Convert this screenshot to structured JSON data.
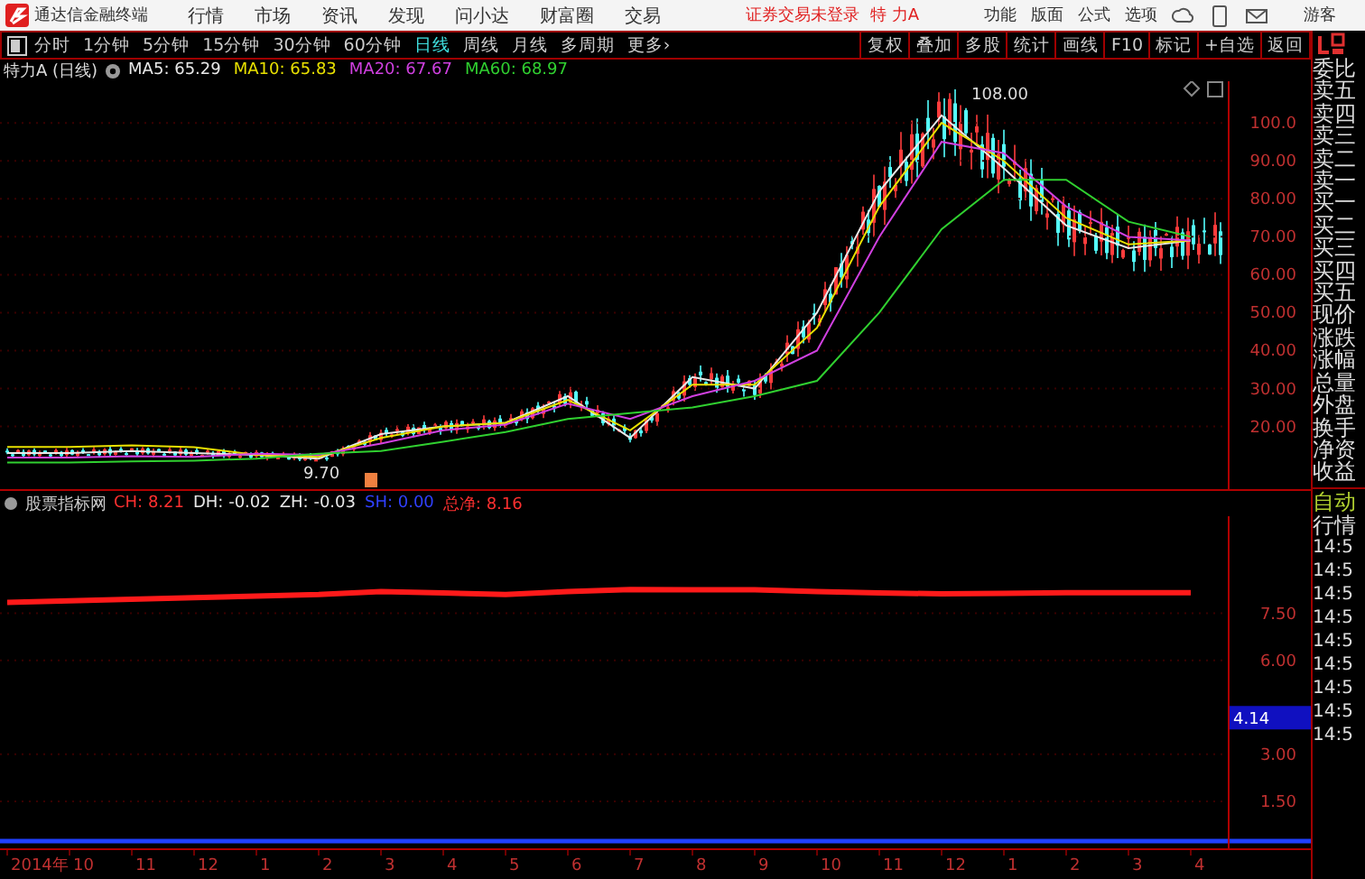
{
  "app_title": "通达信金融终端",
  "menu": [
    "行情",
    "市场",
    "资讯",
    "发现",
    "问小达",
    "财富圈",
    "交易"
  ],
  "login_notice": "证券交易未登录",
  "stock_name": "特 力A",
  "top_links": [
    "功能",
    "版面",
    "公式",
    "选项"
  ],
  "user": "游客",
  "periods": [
    {
      "label": "分时",
      "selected": false
    },
    {
      "label": "1分钟",
      "selected": false
    },
    {
      "label": "5分钟",
      "selected": false
    },
    {
      "label": "15分钟",
      "selected": false
    },
    {
      "label": "30分钟",
      "selected": false
    },
    {
      "label": "60分钟",
      "selected": false
    },
    {
      "label": "日线",
      "selected": true
    },
    {
      "label": "周线",
      "selected": false
    },
    {
      "label": "月线",
      "selected": false
    },
    {
      "label": "多周期",
      "selected": false
    },
    {
      "label": "更多›",
      "selected": false
    }
  ],
  "tools": [
    "复权",
    "叠加",
    "多股",
    "统计",
    "画线",
    "F10",
    "标记",
    "+自选",
    "返回"
  ],
  "chart": {
    "title": "特力A (日线)",
    "ma": [
      {
        "label": "MA5: 65.29",
        "color": "#e8e8e8"
      },
      {
        "label": "MA10: 65.83",
        "color": "#e8e000"
      },
      {
        "label": "MA20: 67.67",
        "color": "#d040e0"
      },
      {
        "label": "MA60: 68.97",
        "color": "#30d030"
      }
    ],
    "high_label": "108.00",
    "low_label": "9.70",
    "chart_data": {
      "type": "line",
      "grid": true,
      "ylim": [
        3,
        111
      ],
      "yticks": [
        {
          "value": 100,
          "label": "100.0"
        },
        {
          "value": 90,
          "label": "90.00"
        },
        {
          "value": 80,
          "label": "80.00"
        },
        {
          "value": 70,
          "label": "70.00"
        },
        {
          "value": 60,
          "label": "60.00"
        },
        {
          "value": 50,
          "label": "50.00"
        },
        {
          "value": 40,
          "label": "40.00"
        },
        {
          "value": 30,
          "label": "30.00"
        },
        {
          "value": 20,
          "label": "20.00"
        }
      ],
      "series": [
        {
          "color": "#e8e8e8",
          "values": [
            13,
            13,
            13.5,
            13,
            12.5,
            11.5,
            18,
            20,
            21,
            28,
            17,
            33,
            30,
            50,
            82,
            102,
            88,
            73,
            67,
            69
          ]
        },
        {
          "color": "#e8e000",
          "values": [
            14.6,
            14.6,
            15,
            14.5,
            12.5,
            12,
            17,
            20,
            21,
            27,
            19,
            31,
            31,
            46,
            78,
            100,
            90,
            75,
            68,
            69
          ]
        },
        {
          "color": "#d040e0",
          "values": [
            11.8,
            11.8,
            12.2,
            12,
            12.8,
            12.5,
            15.5,
            19,
            20.5,
            26,
            22,
            28,
            32,
            40,
            70,
            95,
            92,
            78,
            70,
            69
          ]
        },
        {
          "color": "#30d030",
          "values": [
            10.5,
            10.5,
            10.8,
            11,
            11.5,
            12.8,
            13.5,
            16,
            18.5,
            22,
            23.5,
            25,
            28,
            32,
            50,
            72,
            85,
            85,
            74,
            70
          ]
        }
      ]
    }
  },
  "indicator": {
    "name": "股票指标网",
    "values": [
      {
        "label": "CH: 8.21",
        "color": "#ff3030"
      },
      {
        "label": "DH: -0.02",
        "color": "#e8e8e8"
      },
      {
        "label": "ZH: -0.03",
        "color": "#e8e8e8"
      },
      {
        "label": "SH: 0.00",
        "color": "#3040ff"
      },
      {
        "label": "总净: 8.16",
        "color": "#ff3030"
      }
    ],
    "cursor_value": "4.14",
    "chart_data": {
      "type": "line",
      "grid": true,
      "ylim": [
        0,
        10.6
      ],
      "categories": [
        "2014年",
        "10",
        "11",
        "12",
        "1",
        "2",
        "3",
        "4",
        "5",
        "6",
        "7",
        "8",
        "9",
        "10",
        "11",
        "12",
        "1",
        "2",
        "3",
        "4"
      ],
      "yticks": [
        {
          "value": 7.5,
          "label": "7.50"
        },
        {
          "value": 6,
          "label": "6.00"
        },
        {
          "value": 3,
          "label": "3.00"
        },
        {
          "value": 1.5,
          "label": "1.50"
        }
      ],
      "series": [
        {
          "color": "#ff1a1a",
          "values": [
            7.85,
            7.9,
            7.95,
            8.0,
            8.05,
            8.1,
            8.2,
            8.15,
            8.1,
            8.2,
            8.26,
            8.25,
            8.25,
            8.2,
            8.15,
            8.12,
            8.14,
            8.16,
            8.16,
            8.16
          ]
        }
      ]
    }
  },
  "quote_panel": {
    "labels": [
      "委比",
      "卖五",
      "卖四",
      "卖三",
      "卖二",
      "卖一",
      "买一",
      "买二",
      "买三",
      "买四",
      "买五",
      "现价",
      "涨跌",
      "涨幅",
      "总量",
      "外盘",
      "换手",
      "净资",
      "收益"
    ],
    "mode": "自动",
    "tab": "行情",
    "times": [
      "14:5",
      "14:5",
      "14:5",
      "14:5",
      "14:5",
      "14:5",
      "14:5",
      "14:5",
      "14:5"
    ]
  }
}
